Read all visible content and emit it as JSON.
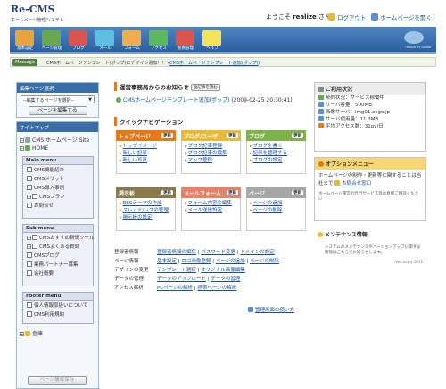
{
  "header": {
    "logo": "Re-CMS",
    "logo_sub": "ホームページ管理システム",
    "welcome_pre": "ようこそ ",
    "user": "realize",
    "welcome_post": " さん",
    "logout": "ログアウト",
    "home_link": "ホームページを開く"
  },
  "nav": {
    "items": [
      {
        "label": "基本設定",
        "icon": "settings-icon",
        "color": "#e8a33c"
      },
      {
        "label": "ページ管理",
        "icon": "page-icon",
        "color": "#6aa84f"
      },
      {
        "label": "ブログ",
        "icon": "blog-icon",
        "color": "#d9534f"
      },
      {
        "label": "メール",
        "icon": "mail-icon",
        "color": "#5bc0de"
      },
      {
        "label": "フォーム",
        "icon": "form-icon",
        "color": "#f0ad4e"
      },
      {
        "label": "アクセス",
        "icon": "stats-icon",
        "color": "#5cb85c"
      },
      {
        "label": "会員管理",
        "icon": "member-icon",
        "color": "#d9534f"
      },
      {
        "label": "ヘルプ",
        "icon": "help-icon",
        "color": "#f7e359"
      }
    ],
    "brand": "realize by Loooo"
  },
  "message": {
    "label": "Message",
    "text": "CMSホームページテンプレート(ポップ)にデザイン追加！！ (",
    "link": "CMSホームページテンプレート追加(ポップ)",
    "end": ")"
  },
  "sidebar": {
    "select_title": "編集ページ選択",
    "select_value": "--編集するページを選択--",
    "edit_button": "ページを編集する",
    "sitemap_title": "サイトマップ",
    "root": "CMS ホームページ Site",
    "home": "HOME",
    "main_menu": {
      "title": "Main menu",
      "items": [
        "CMS機能紹介",
        "CMSメリット",
        "CMS導入事例",
        "CMSプラン",
        "お問合せ"
      ]
    },
    "sub_menu": {
      "title": "Sub menu",
      "items": [
        "CMSおすすめ新規ツール",
        "CMSよくある質問",
        "CMSブログ",
        "業務パートナー募集",
        "会社概要"
      ]
    },
    "footer_menu": {
      "title": "Footer menu",
      "items": [
        "個人情報取扱いについて",
        "CMS利用規約"
      ]
    },
    "trash": "倉庫",
    "save_button": "ページ構成保存"
  },
  "notice": {
    "title": "運営事務局からのお知らせ",
    "all_btn": "全記事を読む",
    "item": "CMSホームページテンプレート追加(ポップ)",
    "date": "(2009-02-25 20:30:41)"
  },
  "quick": {
    "title": "クイックナビゲーション",
    "update": "更新",
    "cards": [
      {
        "title": "トップページ",
        "color": "#e27a1c",
        "items": [
          "トップイメージ",
          "新しい記事",
          "新しい写真"
        ]
      },
      {
        "title": "ブログ/ユーザ",
        "color": "#e8b93a",
        "items": [
          "ブログ記事登録",
          "ブログ記事の編集",
          "マップ登録"
        ]
      },
      {
        "title": "ブログ",
        "color": "#7db349",
        "items": [
          "ブログを書く",
          "記事を管理する",
          "ブログの設定"
        ]
      },
      {
        "title": "掲示板",
        "color": "#8a7a4a",
        "items": [
          "BBSテーマの作成",
          "スレッド/レスの管理",
          "掲示板の設定"
        ]
      },
      {
        "title": "メールフォーム",
        "color": "#e6826a",
        "items": [
          "フォーム内容の編集",
          "メール送信設定"
        ]
      },
      {
        "title": "ページ",
        "color": "#a7a7a7",
        "items": [
          "ページの追加",
          "ページの削除"
        ]
      }
    ]
  },
  "quick_links": [
    {
      "label": "登録者情報",
      "links": [
        "登録者情報の編集",
        "パスワード変更",
        "ドメインの設定"
      ]
    },
    {
      "label": "ページ情報",
      "links": [
        "基本設定",
        "ロゴ画像登録",
        "ページの追加",
        "ページの削除"
      ]
    },
    {
      "label": "デザインの変更",
      "links": [
        "テンプレート選択",
        "オリジナル画像編集"
      ]
    },
    {
      "label": "データの管理",
      "links": [
        "データのアップロード",
        "データの管理"
      ]
    },
    {
      "label": "アクセス解析",
      "links": [
        "PCページの解析",
        "携帯ページの解析"
      ]
    }
  ],
  "usage_link": "管理画面の使い方",
  "status": {
    "title": "ご利用状況",
    "rows": [
      "契約状況：サービス稼働中",
      "サーバ容量：500MB",
      "画像サーバ：img01.ecgo.jp",
      "サーバ使用量：11.3MB",
      "平均アクセス数：31pv/日"
    ]
  },
  "option": {
    "title": "オプションメニュー",
    "text": "ホームページの制作・更新等に関することは当社まで",
    "link": "お問合せ窓口",
    "note": "ホームページ運営の代行サービス等は直接ご相談ください"
  },
  "maintenance": {
    "title": "メンテナンス情報",
    "text": "システムのメンテナンスやバージョンアップに関する情報はこちらでお知らせします。",
    "version": "Ver.ecgo-3.01"
  }
}
